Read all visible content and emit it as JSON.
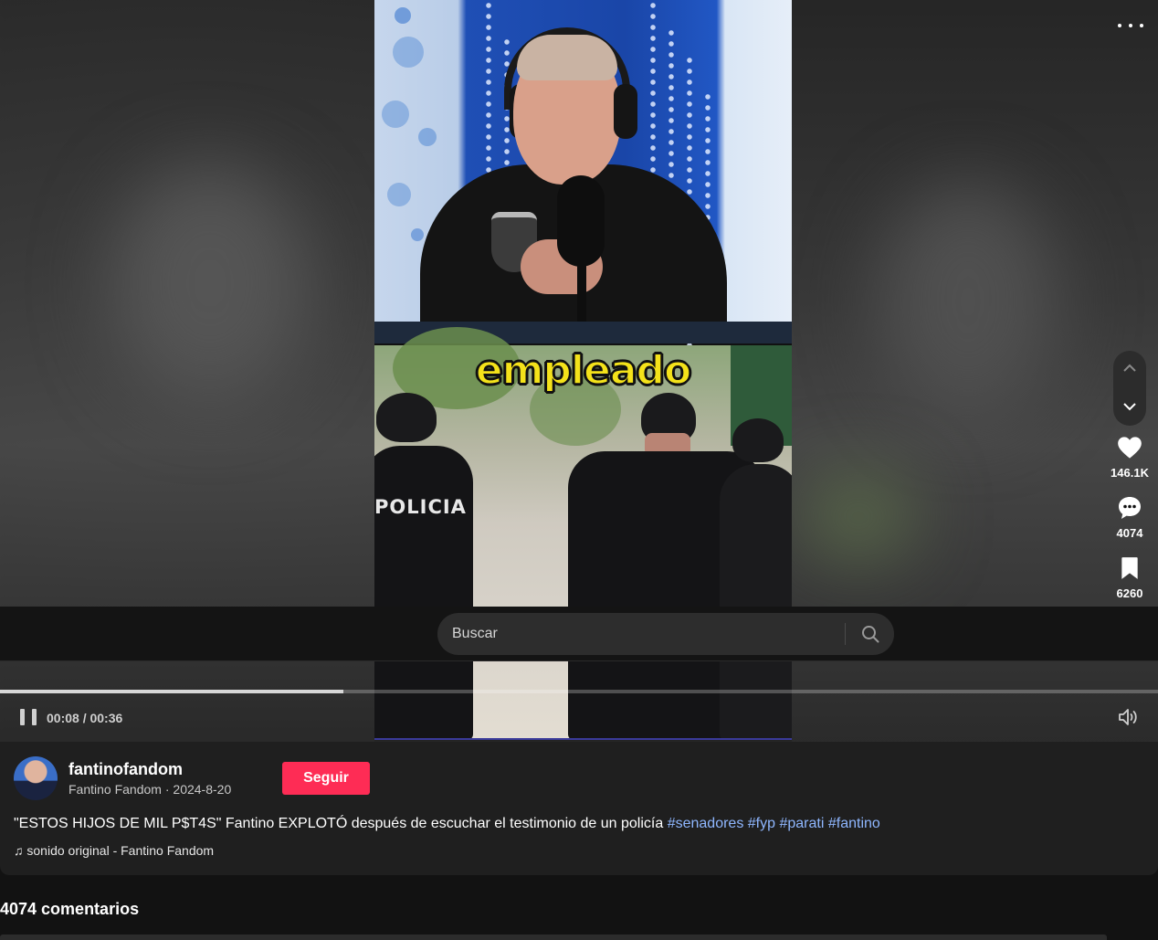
{
  "video": {
    "caption_word": "empleado",
    "uniform_text": "POLICIA"
  },
  "actions": {
    "likes": "146.1K",
    "comments": "4074",
    "saves": "6260"
  },
  "search": {
    "placeholder": "Buscar"
  },
  "player": {
    "time": "00:08 / 00:36",
    "progress": 0.222
  },
  "author": {
    "username": "fantinofandom",
    "display_name": "Fantino Fandom",
    "date": "2024-8-20",
    "separator": " · ",
    "follow_label": "Seguir"
  },
  "description": {
    "text": "\"ESTOS HIJOS DE MIL P$T4S\" Fantino EXPLOTÓ después de escuchar el testimonio de un policía",
    "hashtags": [
      "#senadores",
      "#fyp",
      "#parati",
      "#fantino"
    ]
  },
  "sound": {
    "label": "sonido original - Fantino Fandom",
    "icon": "music-note-icon"
  },
  "comments": {
    "title": "4074 comentarios"
  },
  "colors": {
    "follow": "#fe2c55",
    "hashtag": "#8fb7ff",
    "caption": "#f4e21a"
  }
}
